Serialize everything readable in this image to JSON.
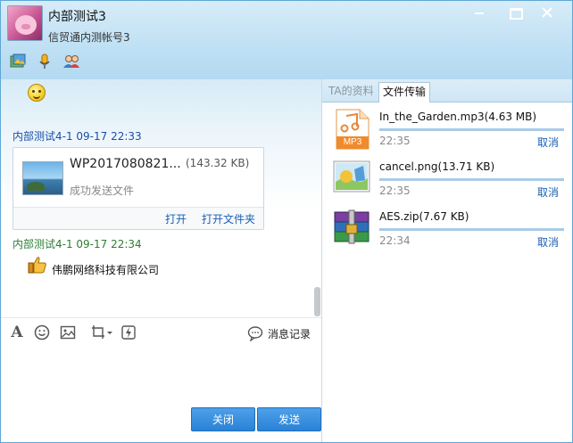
{
  "window": {
    "title": "内部测试3",
    "subtitle": "信贸通内测帐号3",
    "controls": [
      "minimize",
      "maximize",
      "close"
    ]
  },
  "toolbar_icons": [
    "picture-icon",
    "microphone-icon",
    "group-icon"
  ],
  "chat": {
    "messages": [
      {
        "header": "内部测试4-1 09-17 22:33",
        "file": {
          "name": "WP2017080821...",
          "size": "(143.32 KB)",
          "status": "成功发送文件",
          "open_label": "打开",
          "open_folder_label": "打开文件夹"
        }
      },
      {
        "header": "内部测试4-1 09-17 22:34",
        "text": "伟鹏网络科技有限公司"
      }
    ]
  },
  "input_toolbar": {
    "icons": [
      "font-icon",
      "emoji-icon",
      "image-icon",
      "screenshot-icon",
      "shake-icon"
    ],
    "history_label": "消息记录"
  },
  "buttons": {
    "close_label": "关闭",
    "send_label": "发送"
  },
  "right_panel": {
    "tabs": [
      "TA的资料",
      "文件传输"
    ],
    "active_tab": "文件传输",
    "files": [
      {
        "name": "In_the_Garden.mp3(4.63 MB)",
        "time": "22:35",
        "cancel_label": "取消",
        "icon": "mp3-file-icon",
        "icon_label": "MP3",
        "progress": 1.0
      },
      {
        "name": "cancel.png(13.71 KB)",
        "time": "22:35",
        "cancel_label": "取消",
        "icon": "image-file-icon",
        "progress": 1.0
      },
      {
        "name": "AES.zip(7.67 KB)",
        "time": "22:34",
        "cancel_label": "取消",
        "icon": "zip-archive-icon",
        "progress": 1.0
      }
    ]
  },
  "colors": {
    "accent": "#2a82d6",
    "link": "#1a5fb4",
    "header_blue": "#1a4fa8",
    "header_green": "#2e7d32"
  }
}
